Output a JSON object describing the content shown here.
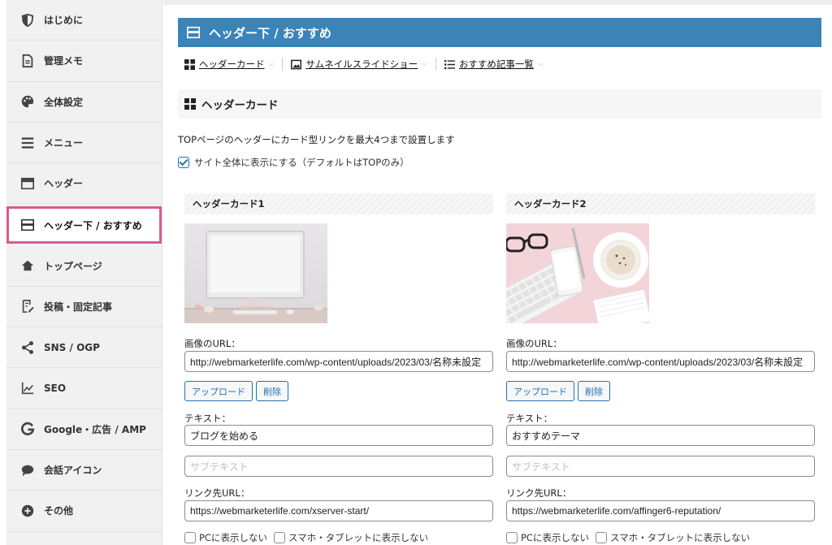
{
  "sidebar": {
    "items": [
      {
        "label": "はじめに",
        "icon": "shield-icon"
      },
      {
        "label": "管理メモ",
        "icon": "document-icon"
      },
      {
        "label": "全体設定",
        "icon": "palette-icon"
      },
      {
        "label": "メニュー",
        "icon": "menu-icon"
      },
      {
        "label": "ヘッダー",
        "icon": "header-layout-icon"
      },
      {
        "label": "ヘッダー下 / おすすめ",
        "icon": "header-below-icon",
        "active": true
      },
      {
        "label": "トップページ",
        "icon": "home-icon"
      },
      {
        "label": "投稿・固定記事",
        "icon": "edit-document-icon"
      },
      {
        "label": "SNS / OGP",
        "icon": "share-icon"
      },
      {
        "label": "SEO",
        "icon": "chart-line-icon"
      },
      {
        "label": "Google・広告 / AMP",
        "icon": "google-icon"
      },
      {
        "label": "会話アイコン",
        "icon": "speech-bubble-icon"
      },
      {
        "label": "その他",
        "icon": "plus-circle-icon"
      }
    ]
  },
  "page": {
    "title": "ヘッダー下 / おすすめ",
    "title_bar_color": "#3a84b8",
    "active_highlight_color": "#d95b93"
  },
  "subnav": [
    {
      "label": "ヘッダーカード",
      "icon": "grid-icon"
    },
    {
      "label": "サムネイルスライドショー",
      "icon": "image-icon"
    },
    {
      "label": "おすすめ記事一覧",
      "icon": "list-icon"
    }
  ],
  "section": {
    "title": "ヘッダーカード",
    "description": "TOPページのヘッダーにカード型リンクを最大4つまで設置します",
    "show_all_label": "サイト全体に表示にする（デフォルトはTOPのみ）",
    "show_all_checked": true
  },
  "cards": [
    {
      "heading": "ヘッダーカード1",
      "image_url_label": "画像のURL：",
      "image_url": "http://webmarketerlife.com/wp-content/uploads/2023/03/名称未設定",
      "upload_label": "アップロード",
      "delete_label": "削除",
      "text_label": "テキスト：",
      "text_value": "ブログを始める",
      "subtext_placeholder": "サブテキスト",
      "link_label": "リンク先URL：",
      "link_value": "https://webmarketerlife.com/xserver-start/",
      "hide_pc_label": "PCに表示しない",
      "hide_sp_label": "スマホ・タブレットに表示しない"
    },
    {
      "heading": "ヘッダーカード2",
      "image_url_label": "画像のURL：",
      "image_url": "http://webmarketerlife.com/wp-content/uploads/2023/03/名称未設定",
      "upload_label": "アップロード",
      "delete_label": "削除",
      "text_label": "テキスト：",
      "text_value": "おすすめテーマ",
      "subtext_placeholder": "サブテキスト",
      "link_label": "リンク先URL：",
      "link_value": "https://webmarketerlife.com/affinger6-reputation/",
      "hide_pc_label": "PCに表示しない",
      "hide_sp_label": "スマホ・タブレットに表示しない"
    }
  ]
}
